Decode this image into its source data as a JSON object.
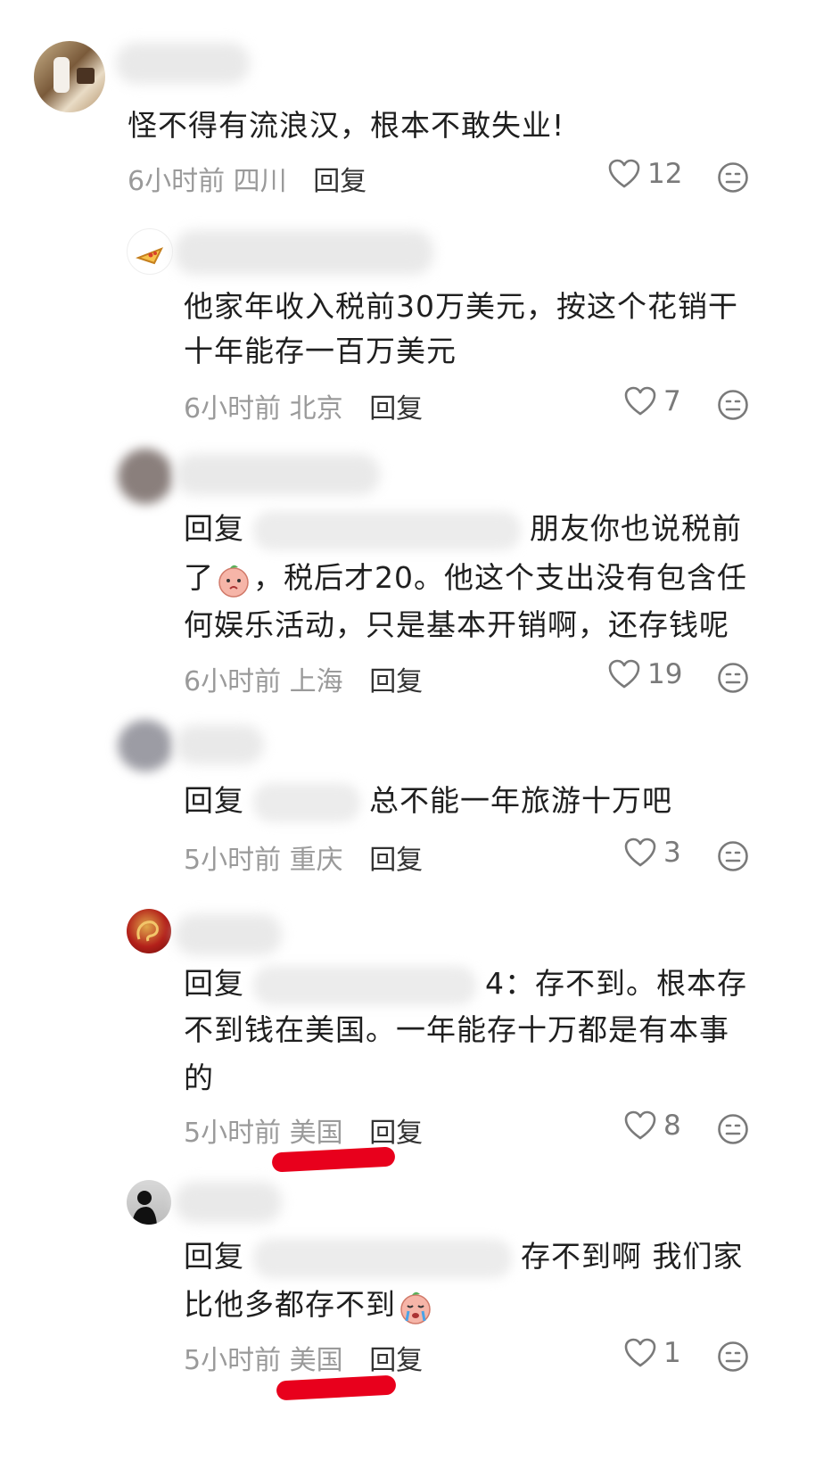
{
  "comments": [
    {
      "text": "怪不得有流浪汉，根本不敢失业!",
      "time": "6小时前",
      "location": "四川",
      "reply_label": "回复",
      "likes": "12",
      "avatar_icon": "restaurant-photo-avatar"
    },
    {
      "text_line1": "他家年收入税前30万美元，按这个花销干",
      "text_line2": "十年能存一百万美元",
      "time": "6小时前",
      "location": "北京",
      "reply_label": "回复",
      "likes": "7",
      "avatar_icon": "pizza-avatar"
    },
    {
      "reply_prefix": "回复",
      "text_line1_suffix": "朋友你也说税前",
      "text_line2_pre": "了",
      "text_line2_post": "，税后才20。他这个支出没有包含任",
      "text_line3": "何娱乐活动，只是基本开销啊，还存钱呢",
      "time": "6小时前",
      "location": "上海",
      "reply_label": "回复",
      "likes": "19",
      "avatar_icon": "blurred-avatar"
    },
    {
      "reply_prefix": "回复",
      "text_suffix": "总不能一年旅游十万吧",
      "time": "5小时前",
      "location": "重庆",
      "reply_label": "回复",
      "likes": "3",
      "avatar_icon": "blurred-avatar"
    },
    {
      "reply_prefix": "回复",
      "text_line1_suffix": "4：存不到。根本存",
      "text_line2": "不到钱在美国。一年能存十万都是有本事",
      "text_line3": "的",
      "time": "5小时前",
      "location": "美国",
      "reply_label": "回复",
      "likes": "8",
      "avatar_icon": "dragon-avatar"
    },
    {
      "reply_prefix": "回复",
      "text_line1_suffix": "存不到啊 我们家",
      "text_line2": "比他多都存不到",
      "time": "5小时前",
      "location": "美国",
      "reply_label": "回复",
      "likes": "1",
      "avatar_icon": "silhouette-avatar"
    }
  ],
  "colors": {
    "annotation": "#e8001c",
    "meta": "#9a9a9a",
    "text": "#1f1f1f"
  }
}
